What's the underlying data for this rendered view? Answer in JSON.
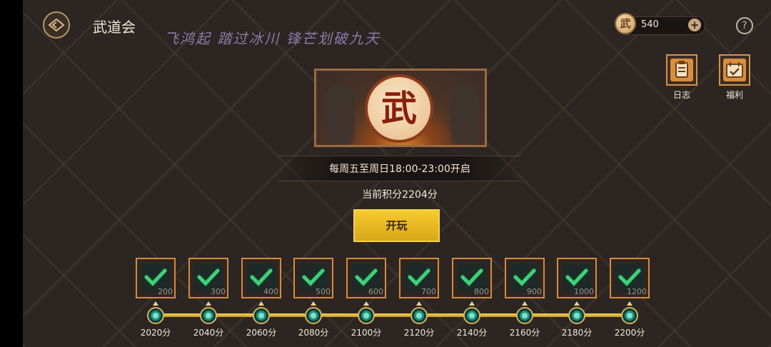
{
  "header": {
    "title": "武道会",
    "slogan": "飞鸿起 踏过冰川 锋芒划破九天",
    "currency_icon_text": "武",
    "currency_value": "540",
    "plus_label": "+",
    "help_label": "?"
  },
  "side_buttons": [
    {
      "label": "日志",
      "icon": "log-clipboard-icon"
    },
    {
      "label": "福利",
      "icon": "welfare-calendar-icon"
    }
  ],
  "banner": {
    "emblem_text": "武"
  },
  "schedule": "每周五至周日18:00-23:00开启",
  "current_points": "当前积分2204分",
  "play_button": "开玩",
  "rewards": [
    {
      "cost": "200",
      "threshold": "2020分",
      "claimed": true
    },
    {
      "cost": "300",
      "threshold": "2040分",
      "claimed": true
    },
    {
      "cost": "400",
      "threshold": "2060分",
      "claimed": true
    },
    {
      "cost": "500",
      "threshold": "2080分",
      "claimed": true
    },
    {
      "cost": "600",
      "threshold": "2100分",
      "claimed": true
    },
    {
      "cost": "700",
      "threshold": "2120分",
      "claimed": true
    },
    {
      "cost": "800",
      "threshold": "2140分",
      "claimed": true
    },
    {
      "cost": "900",
      "threshold": "2160分",
      "claimed": true
    },
    {
      "cost": "1000",
      "threshold": "2180分",
      "claimed": true
    },
    {
      "cost": "1200",
      "threshold": "2200分",
      "claimed": true
    }
  ],
  "colors": {
    "accent_gold": "#f6cb2c",
    "frame_orange": "#d68b3a",
    "check_green": "#3fd07a",
    "slogan_purple": "#8a7aa8"
  }
}
